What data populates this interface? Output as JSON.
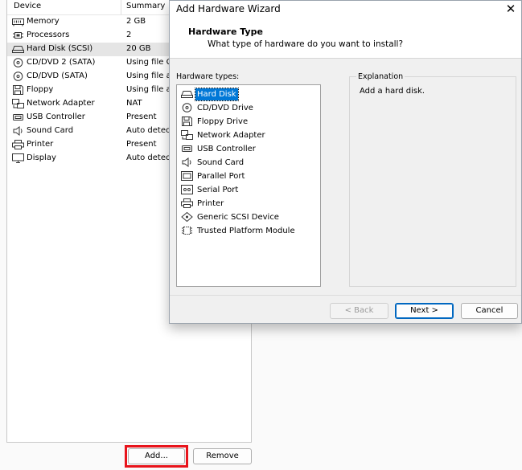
{
  "device_panel": {
    "columns": {
      "device": "Device",
      "summary": "Summary"
    },
    "devices": [
      {
        "name": "Memory",
        "summary": "2 GB",
        "icon": "memory-icon"
      },
      {
        "name": "Processors",
        "summary": "2",
        "icon": "processor-icon"
      },
      {
        "name": "Hard Disk (SCSI)",
        "summary": "20 GB",
        "icon": "hard-disk-icon",
        "selected": true
      },
      {
        "name": "CD/DVD 2 (SATA)",
        "summary": "Using file C:",
        "icon": "cd-dvd-icon"
      },
      {
        "name": "CD/DVD (SATA)",
        "summary": "Using file au",
        "icon": "cd-dvd-icon"
      },
      {
        "name": "Floppy",
        "summary": "Using file au",
        "icon": "floppy-icon"
      },
      {
        "name": "Network Adapter",
        "summary": "NAT",
        "icon": "network-adapter-icon"
      },
      {
        "name": "USB Controller",
        "summary": "Present",
        "icon": "usb-icon"
      },
      {
        "name": "Sound Card",
        "summary": "Auto detect",
        "icon": "sound-card-icon"
      },
      {
        "name": "Printer",
        "summary": "Present",
        "icon": "printer-icon"
      },
      {
        "name": "Display",
        "summary": "Auto detect",
        "icon": "display-icon"
      }
    ],
    "add_label": "Add...",
    "remove_label": "Remove"
  },
  "wizard": {
    "title": "Add Hardware Wizard",
    "close_glyph": "✕",
    "heading": "Hardware Type",
    "subheading": "What type of hardware do you want to install?",
    "list_label": "Hardware types:",
    "hardware_types": [
      {
        "label": "Hard Disk",
        "icon": "hard-disk-icon",
        "selected": true
      },
      {
        "label": "CD/DVD Drive",
        "icon": "cd-dvd-icon"
      },
      {
        "label": "Floppy Drive",
        "icon": "floppy-icon"
      },
      {
        "label": "Network Adapter",
        "icon": "network-adapter-icon"
      },
      {
        "label": "USB Controller",
        "icon": "usb-icon"
      },
      {
        "label": "Sound Card",
        "icon": "sound-card-icon"
      },
      {
        "label": "Parallel Port",
        "icon": "parallel-port-icon"
      },
      {
        "label": "Serial Port",
        "icon": "serial-port-icon"
      },
      {
        "label": "Printer",
        "icon": "printer-icon"
      },
      {
        "label": "Generic SCSI Device",
        "icon": "scsi-device-icon"
      },
      {
        "label": "Trusted Platform Module",
        "icon": "tpm-icon"
      }
    ],
    "explanation_label": "Explanation",
    "explanation_text": "Add a hard disk.",
    "back_label": "< Back",
    "next_label": "Next >",
    "cancel_label": "Cancel"
  },
  "colors": {
    "selection": "#0078d7",
    "highlight_box": "#e8141c",
    "default_button_border": "#0067c0"
  }
}
